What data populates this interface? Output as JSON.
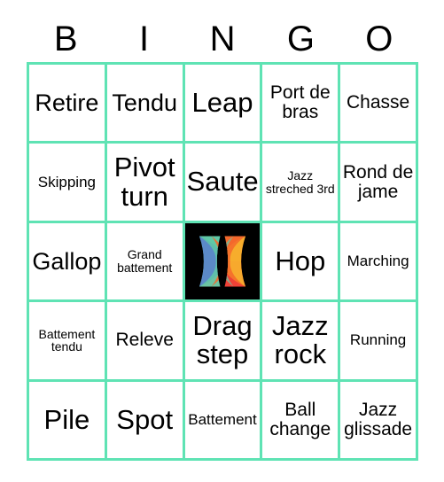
{
  "header": {
    "letters": [
      "B",
      "I",
      "N",
      "G",
      "O"
    ]
  },
  "grid": {
    "border_color": "#5fe3b4",
    "free_space_bg": "#000000",
    "cells": [
      {
        "label": "Retire",
        "size": "lg"
      },
      {
        "label": "Tendu",
        "size": "lg"
      },
      {
        "label": "Leap",
        "size": "xl"
      },
      {
        "label": "Port de bras",
        "size": "md"
      },
      {
        "label": "Chasse",
        "size": "md"
      },
      {
        "label": "Skipping",
        "size": "sm"
      },
      {
        "label": "Pivot turn",
        "size": "xl"
      },
      {
        "label": "Saute",
        "size": "xl"
      },
      {
        "label": "Jazz streched 3rd",
        "size": "xs"
      },
      {
        "label": "Rond de jame",
        "size": "md"
      },
      {
        "label": "Gallop",
        "size": "lg"
      },
      {
        "label": "Grand battement",
        "size": "xs"
      },
      {
        "label": "",
        "size": "free"
      },
      {
        "label": "Hop",
        "size": "xl"
      },
      {
        "label": "Marching",
        "size": "sm"
      },
      {
        "label": "Battement tendu",
        "size": "xs"
      },
      {
        "label": "Releve",
        "size": "md"
      },
      {
        "label": "Drag step",
        "size": "xl"
      },
      {
        "label": "Jazz rock",
        "size": "xl"
      },
      {
        "label": "Running",
        "size": "sm"
      },
      {
        "label": "Pile",
        "size": "xl"
      },
      {
        "label": "Spot",
        "size": "xl"
      },
      {
        "label": "Battement",
        "size": "sm"
      },
      {
        "label": "Ball change",
        "size": "md"
      },
      {
        "label": "Jazz glissade",
        "size": "md"
      }
    ]
  },
  "free_space_logo": {
    "name": "bingo-free-space-logo",
    "colors": {
      "teal": "#5fc9a6",
      "blue": "#5b86c8",
      "orange": "#f4682c",
      "yellow": "#f7b52c",
      "red": "#ef4136",
      "green": "#6cc4a1"
    }
  }
}
